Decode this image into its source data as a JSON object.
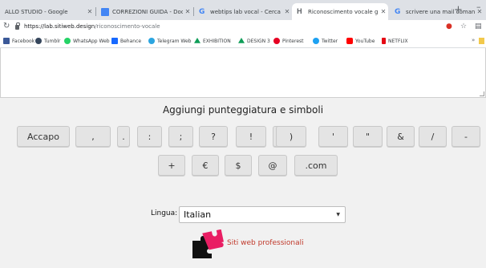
{
  "browser": {
    "tabs": [
      {
        "title": "ALLO STUDIO - Google",
        "icon": "docs-sheet-icon",
        "active": false
      },
      {
        "title": "CORREZIONI GUIDA - Documen",
        "icon": "google-docs-icon",
        "active": false
      },
      {
        "title": "webtips lab vocal - Cerca con G",
        "icon": "google-search-icon",
        "active": false
      },
      {
        "title": "Riconoscimento vocale gratis",
        "icon": "page-icon",
        "active": true
      },
      {
        "title": "scrivere una mail comando voc",
        "icon": "google-search-icon",
        "active": false
      }
    ],
    "url_domain": "https://lab.sitiweb.design",
    "url_path": "/riconoscimento-vocale",
    "bookmarks": [
      {
        "label": "Facebook",
        "color": "#3b5998"
      },
      {
        "label": "Tumblr",
        "color": "#35465c"
      },
      {
        "label": "WhatsApp Web",
        "color": "#25d366"
      },
      {
        "label": "Behance",
        "color": "#1769ff"
      },
      {
        "label": "Telegram Web",
        "color": "#2ca5e0"
      },
      {
        "label": "EXHIBITION",
        "color": "#0f9d58"
      },
      {
        "label": "DESIGN 3",
        "color": "#0f9d58"
      },
      {
        "label": "Pinterest",
        "color": "#e60023"
      },
      {
        "label": "Twitter",
        "color": "#1da1f2"
      },
      {
        "label": "YouTube",
        "color": "#ff0000"
      },
      {
        "label": "NETFLIX",
        "color": "#e50914"
      }
    ]
  },
  "page": {
    "section_title": "Aggiungi punteggiatura e simboli",
    "row1_buttons": [
      "Accapo",
      ",",
      ".",
      ":",
      ";",
      "?",
      "!",
      "(",
      ")",
      "'",
      "\"",
      "&",
      "/",
      "-"
    ],
    "row2_buttons": [
      "+",
      "€",
      "$",
      "@",
      ".com"
    ],
    "language_label": "Lingua:",
    "language_value": "Italian",
    "brand_text": "Siti web professionali",
    "brand_color": "#c0392b"
  }
}
